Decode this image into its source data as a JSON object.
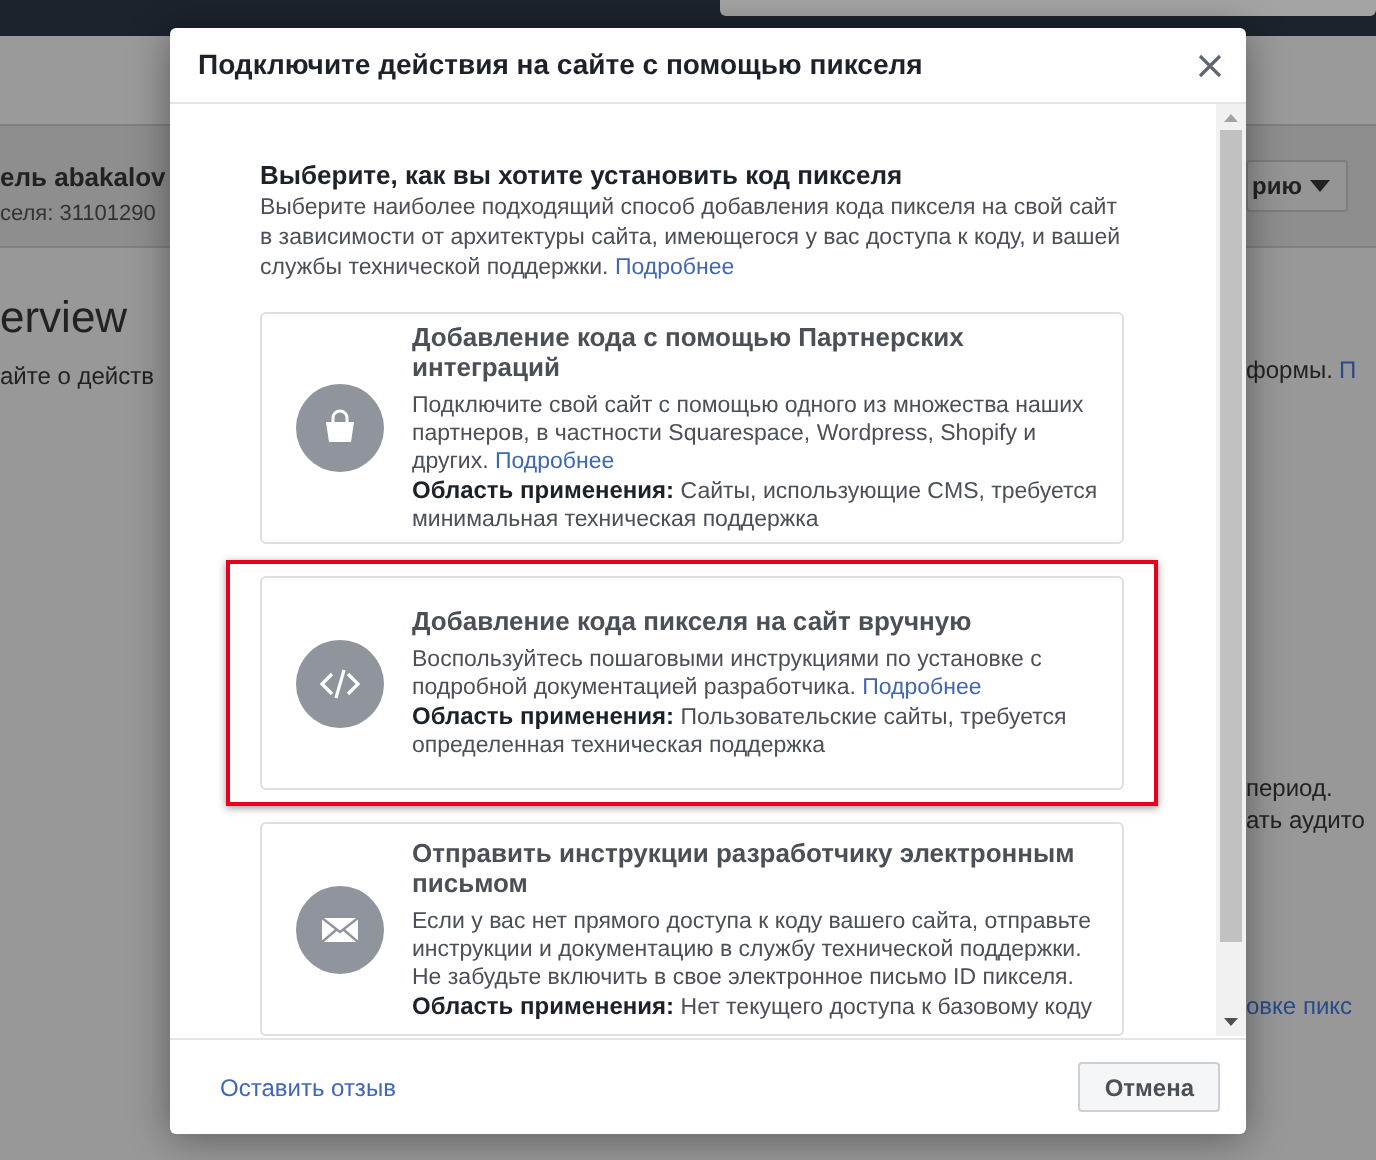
{
  "background": {
    "left_texts": [
      "ель abakalov",
      "селя: 31101290",
      "erview",
      "айте о действ"
    ],
    "dropdown": {
      "label": "рию"
    },
    "right_texts": [
      {
        "text": "формы.",
        "link": "П"
      },
      {
        "text": "период."
      },
      {
        "text": "ать аудито"
      },
      {
        "link": "овке пикс"
      }
    ]
  },
  "dialog": {
    "title": "Подключите действия на сайте с помощью пикселя",
    "heading": "Выберите, как вы хотите установить код пикселя",
    "intro": "Выберите наиболее подходящий способ добавления кода пикселя на свой сайт в зависимости от архитектуры сайта, имеющегося у вас доступа к коду, и вашей службы технической поддержки.",
    "intro_link": "Подробнее",
    "options": [
      {
        "kind": "bag",
        "highlighted": false,
        "title": "Добавление кода с помощью Партнерских интеграций",
        "description": "Подключите свой сайт с помощью одного из множества наших партнеров, в частности Squarespace, Wordpress, Shopify и других.",
        "link": "Подробнее",
        "scope_label": "Область применения:",
        "scope_text": "Сайты, использующие CMS, требуется минимальная техническая поддержка"
      },
      {
        "kind": "code",
        "highlighted": true,
        "title": "Добавление кода пикселя на сайт вручную",
        "description": "Воспользуйтесь пошаговыми инструкциями по установке с подробной документацией разработчика.",
        "link": "Подробнее",
        "scope_label": "Область применения:",
        "scope_text": "Пользовательские сайты, требуется определенная техническая поддержка"
      },
      {
        "kind": "mail",
        "highlighted": false,
        "title": "Отправить инструкции разработчику электронным письмом",
        "description": "Если у вас нет прямого доступа к коду вашего сайта, отправьте инструкции и документацию в службу технической поддержки. Не забудьте включить в свое электронное письмо ID пикселя.",
        "scope_label": "Область применения:",
        "scope_text": "Нет текущего доступа к базовому коду"
      }
    ],
    "feedback_link": "Оставить отзыв",
    "cancel_button": "Отмена"
  }
}
